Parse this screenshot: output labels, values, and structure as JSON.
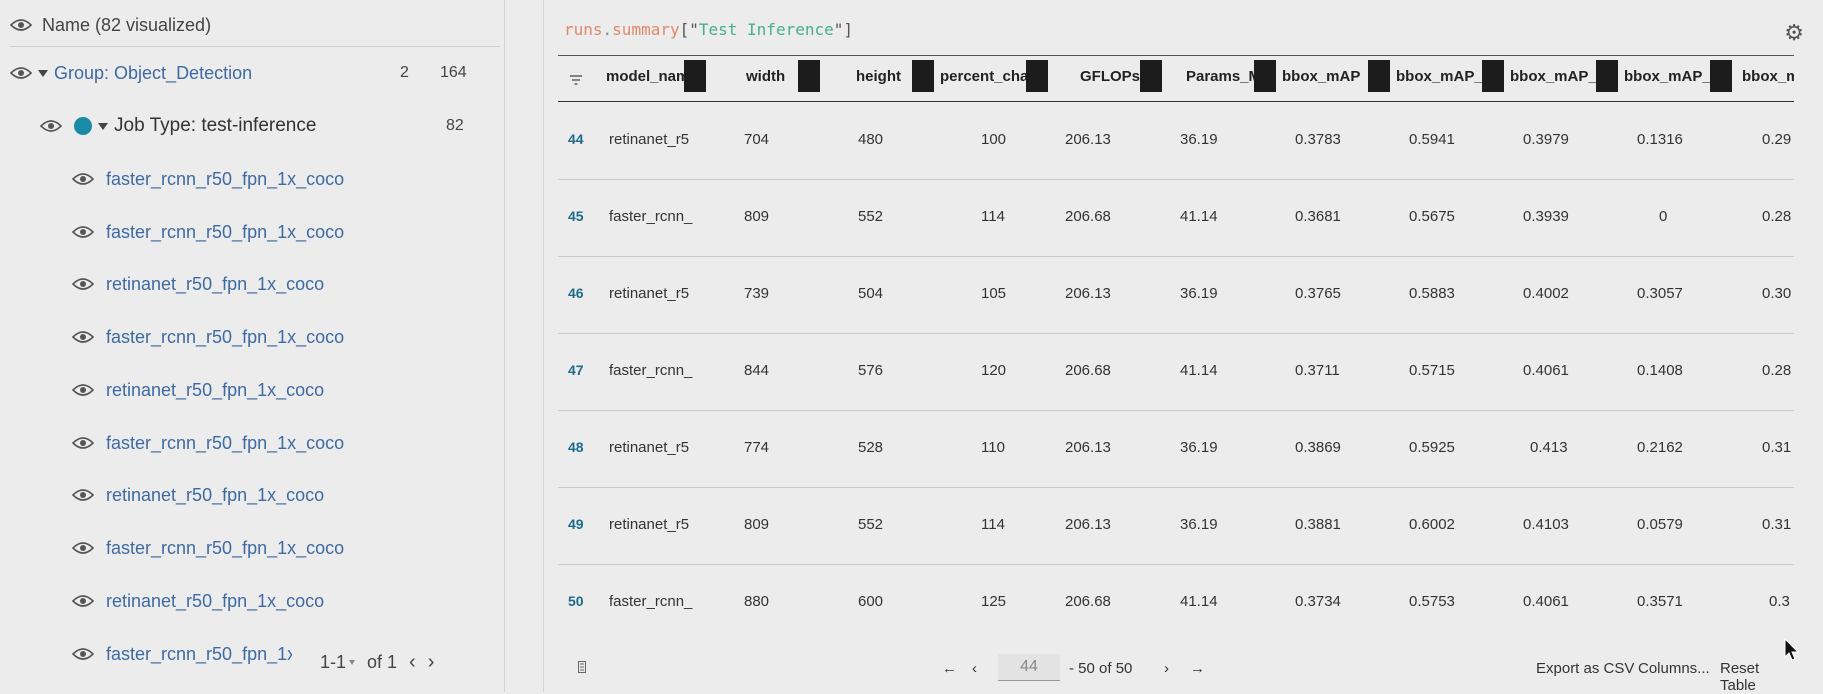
{
  "sidebar": {
    "name_header": "Name (82 visualized)",
    "group": {
      "label": "Group: Object_Detection",
      "count_a": "2",
      "count_b": "164"
    },
    "job": {
      "label": "Job Type: test-inference",
      "count": "82"
    },
    "runs": [
      "faster_rcnn_r50_fpn_1x_coco",
      "faster_rcnn_r50_fpn_1x_coco",
      "retinanet_r50_fpn_1x_coco",
      "faster_rcnn_r50_fpn_1x_coco",
      "retinanet_r50_fpn_1x_coco",
      "faster_rcnn_r50_fpn_1x_coco",
      "retinanet_r50_fpn_1x_coco",
      "faster_rcnn_r50_fpn_1x_coco",
      "retinanet_r50_fpn_1x_coco",
      "faster_rcnn_r50_fpn_1x"
    ],
    "pager": {
      "range": "1-1",
      "of": "of 1"
    }
  },
  "query": {
    "obj": "runs",
    "dot": ".",
    "method": "summary",
    "open": "[\"",
    "arg": "Test Inference",
    "close": "\"]"
  },
  "table": {
    "columns": [
      "model_nam",
      "width",
      "height",
      "percent_cha",
      "GFLOPs",
      "Params_M",
      "bbox_mAP",
      "bbox_mAP_",
      "bbox_mAP_",
      "bbox_mAP_",
      "bbox_m"
    ],
    "rows": [
      {
        "idx": "44",
        "cells": [
          "retinanet_r5",
          "704",
          "480",
          "100",
          "206.13",
          "36.19",
          "0.3783",
          "0.5941",
          "0.3979",
          "0.1316",
          "0.29"
        ]
      },
      {
        "idx": "45",
        "cells": [
          "faster_rcnn_",
          "809",
          "552",
          "114",
          "206.68",
          "41.14",
          "0.3681",
          "0.5675",
          "0.3939",
          "0",
          "0.28"
        ]
      },
      {
        "idx": "46",
        "cells": [
          "retinanet_r5",
          "739",
          "504",
          "105",
          "206.13",
          "36.19",
          "0.3765",
          "0.5883",
          "0.4002",
          "0.3057",
          "0.30"
        ]
      },
      {
        "idx": "47",
        "cells": [
          "faster_rcnn_",
          "844",
          "576",
          "120",
          "206.68",
          "41.14",
          "0.3711",
          "0.5715",
          "0.4061",
          "0.1408",
          "0.28"
        ]
      },
      {
        "idx": "48",
        "cells": [
          "retinanet_r5",
          "774",
          "528",
          "110",
          "206.13",
          "36.19",
          "0.3869",
          "0.5925",
          "0.413",
          "0.2162",
          "0.31"
        ]
      },
      {
        "idx": "49",
        "cells": [
          "retinanet_r5",
          "809",
          "552",
          "114",
          "206.13",
          "36.19",
          "0.3881",
          "0.6002",
          "0.4103",
          "0.0579",
          "0.31"
        ]
      },
      {
        "idx": "50",
        "cells": [
          "faster_rcnn_",
          "880",
          "600",
          "125",
          "206.68",
          "41.14",
          "0.3734",
          "0.5753",
          "0.4061",
          "0.3571",
          "0.3"
        ]
      }
    ]
  },
  "footer": {
    "first": "←",
    "prev": "‹",
    "page": "44",
    "range": "- 50 of 50",
    "next": "›",
    "last": "→",
    "export": "Export as CSV",
    "columns": "Columns...",
    "reset": "Reset Table"
  },
  "colors": {
    "accent": "#1a8aa7",
    "link": "#3e6aa3",
    "index": "#1f6b8c"
  }
}
